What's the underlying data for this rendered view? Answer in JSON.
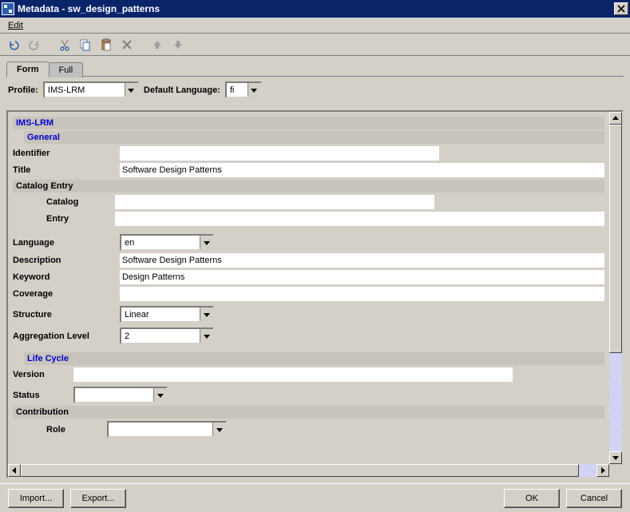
{
  "window": {
    "title": "Metadata - sw_design_patterns"
  },
  "menu": {
    "edit": "Edit"
  },
  "toolbar_icons": {
    "undo": "undo-icon",
    "redo": "redo-icon",
    "cut": "cut-icon",
    "copy": "copy-icon",
    "paste": "paste-icon",
    "delete": "delete-icon",
    "up": "arrow-up-icon",
    "down": "arrow-down-icon"
  },
  "tabs": {
    "form": "Form",
    "full": "Full"
  },
  "profile": {
    "label": "Profile:",
    "value": "IMS-LRM",
    "default_lang_label": "Default Language:",
    "default_lang_value": "fi"
  },
  "form": {
    "root_header": "IMS-LRM",
    "general": {
      "header": "General",
      "identifier_label": "Identifier",
      "identifier_value": "",
      "title_label": "Title",
      "title_value": "Software Design Patterns",
      "catalog_entry_header": "Catalog Entry",
      "catalog_label": "Catalog",
      "catalog_value": "",
      "entry_label": "Entry",
      "entry_value": "",
      "language_label": "Language",
      "language_value": "en",
      "description_label": "Description",
      "description_value": "Software Design Patterns",
      "keyword_label": "Keyword",
      "keyword_value": "Design Patterns",
      "coverage_label": "Coverage",
      "coverage_value": "",
      "structure_label": "Structure",
      "structure_value": "Linear",
      "agg_label": "Aggregation Level",
      "agg_value": "2"
    },
    "lifecycle": {
      "header": "Life Cycle",
      "version_label": "Version",
      "version_value": "",
      "status_label": "Status",
      "status_value": "",
      "contribution_header": "Contribution",
      "role_label": "Role",
      "role_value": ""
    }
  },
  "buttons": {
    "import": "Import...",
    "export": "Export...",
    "ok": "OK",
    "cancel": "Cancel"
  }
}
